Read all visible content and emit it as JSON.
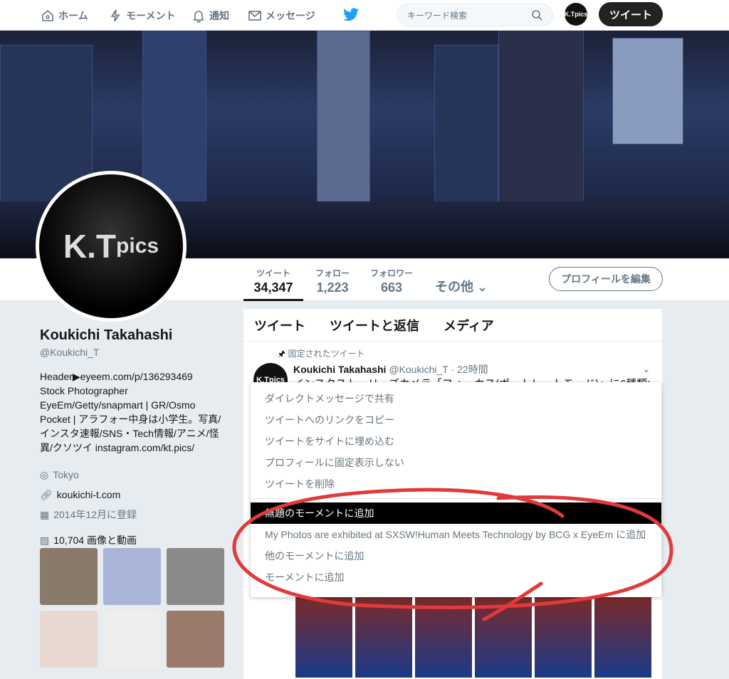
{
  "topbar": {
    "nav": [
      {
        "icon": "home-icon",
        "label": "ホーム"
      },
      {
        "icon": "lightning-icon",
        "label": "モーメント"
      },
      {
        "icon": "bell-icon",
        "label": "通知"
      },
      {
        "icon": "envelope-icon",
        "label": "メッセージ"
      }
    ],
    "search_placeholder": "キーワード検索",
    "avatar_text": "K.Tpics",
    "tweet_button": "ツイート"
  },
  "profile": {
    "avatar_main": "K.T",
    "avatar_sub": "pics",
    "name": "Koukichi Takahashi",
    "handle": "@Koukichi_T",
    "bio": [
      "Header▶eyeem.com/p/136293469",
      "Stock Photographer",
      "EyeEm/Getty/snapmart | GR/Osmo",
      "Pocket | アラフォー中身は小学生。写真/",
      "インスタ速報/SNS・Tech情報/アニメ/怪",
      "異/クソツイ instagram.com/kt.pics/"
    ],
    "location": "Tokyo",
    "website": "koukichi-t.com",
    "joined": "2014年12月に登録",
    "media_count": "10,704 画像と動画"
  },
  "stats": [
    {
      "label": "ツイート",
      "value": "34,347"
    },
    {
      "label": "フォロー",
      "value": "1,223"
    },
    {
      "label": "フォロワー",
      "value": "663"
    }
  ],
  "more_label": "その他",
  "edit_profile": "プロフィールを編集",
  "tabs": [
    "ツイート",
    "ツイートと返信",
    "メディア"
  ],
  "tweet": {
    "pinned": "固定されたツイート",
    "name": "Koukichi Takahashi",
    "handle": "@Koukichi_T",
    "time": "· 22時間",
    "text": "インスタストーリーズカメラ「フォーカス(ポートレートモード)」に6種類("
  },
  "menu": {
    "items": [
      "ダイレクトメッセージで共有",
      "ツイートへのリンクをコピー",
      "ツイートをサイトに埋め込む",
      "プロフィールに固定表示しない",
      "ツイートを削除"
    ],
    "moment_items": [
      "無題のモーメントに追加",
      "My Photos are exhibited at SXSW!Human Meets Technology by BCG x EyeEm に追加",
      "他のモーメントに追加",
      "モーメントに追加"
    ],
    "selected": "無題のモーメントに追加"
  },
  "colors": {
    "accent": "#1da1f2",
    "annotation": "#e03a3a"
  }
}
